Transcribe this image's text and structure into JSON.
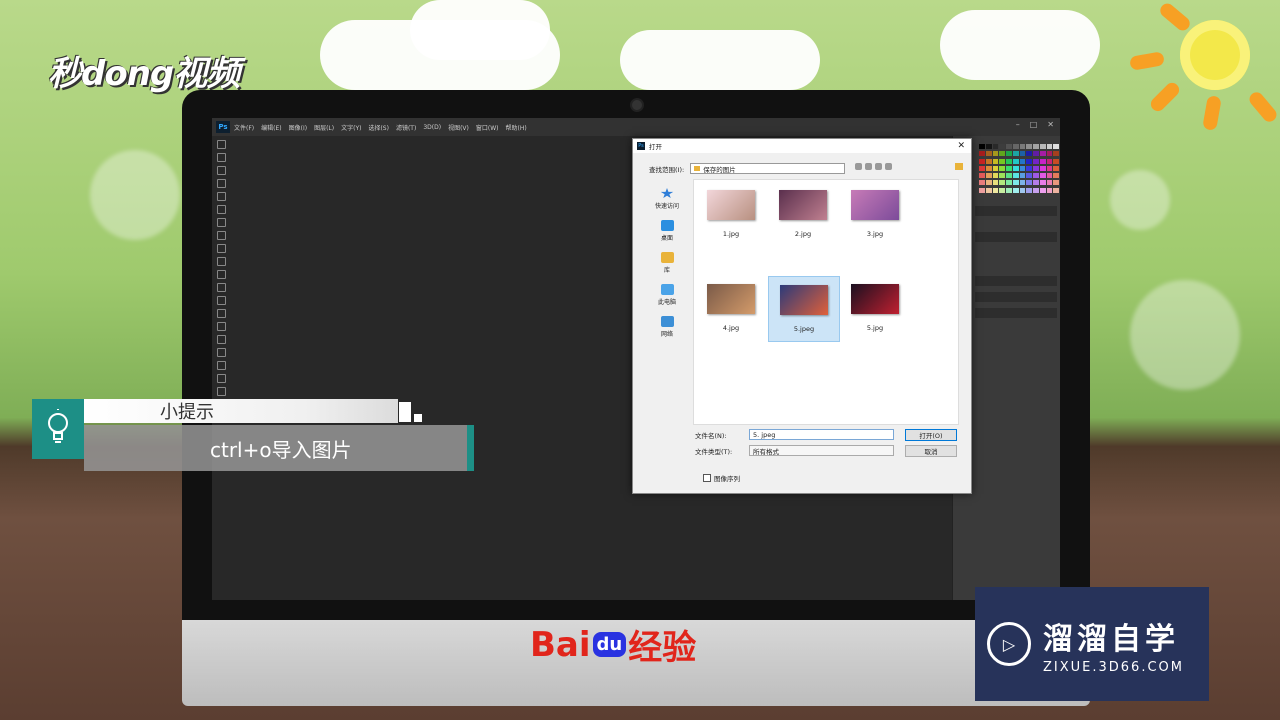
{
  "brand_logo": "秒dong视频",
  "photoshop": {
    "app_logo": "Ps",
    "menu": [
      "文件(F)",
      "编辑(E)",
      "图像(I)",
      "图层(L)",
      "文字(Y)",
      "选择(S)",
      "滤镜(T)",
      "3D(D)",
      "视图(V)",
      "窗口(W)",
      "帮助(H)"
    ]
  },
  "open_dialog": {
    "title": "打开",
    "look_in_label": "查找范围(I):",
    "look_in_value": "保存的图片",
    "places": [
      {
        "label": "快速访问",
        "icon": "star-icon",
        "color": "#2f7ed8"
      },
      {
        "label": "桌面",
        "icon": "desktop-icon",
        "color": "#2b8fe0"
      },
      {
        "label": "库",
        "icon": "library-icon",
        "color": "#e9b33a"
      },
      {
        "label": "此电脑",
        "icon": "computer-icon",
        "color": "#4aa3e8"
      },
      {
        "label": "网络",
        "icon": "network-icon",
        "color": "#3c8fd6"
      }
    ],
    "files": [
      {
        "name": "1.jpg",
        "selected": false,
        "colors": [
          "#f2d6da",
          "#b89080"
        ]
      },
      {
        "name": "2.jpg",
        "selected": false,
        "colors": [
          "#5a2f4d",
          "#c08090"
        ]
      },
      {
        "name": "3.jpg",
        "selected": false,
        "colors": [
          "#c77bb7",
          "#7c4b9a"
        ]
      },
      {
        "name": "4.jpg",
        "selected": false,
        "colors": [
          "#7a5a48",
          "#d49b6a"
        ]
      },
      {
        "name": "5.jpeg",
        "selected": true,
        "colors": [
          "#2b3a7a",
          "#e0603a"
        ]
      },
      {
        "name": "5.jpg",
        "selected": false,
        "colors": [
          "#1a1020",
          "#c02030"
        ]
      }
    ],
    "filename_label": "文件名(N):",
    "filename_value": "5. jpeg",
    "filetype_label": "文件类型(T):",
    "filetype_value": "所有格式",
    "open_button": "打开(O)",
    "cancel_button": "取消",
    "sequence_checkbox": "图像序列"
  },
  "tip": {
    "heading": "小提示",
    "body": "ctrl+o导入图片"
  },
  "baidu": {
    "bai": "Bai",
    "du": "du",
    "jingyan": "经验"
  },
  "zixue": {
    "cn": "溜溜自学",
    "en": "ZIXUE.3D66.COM"
  }
}
